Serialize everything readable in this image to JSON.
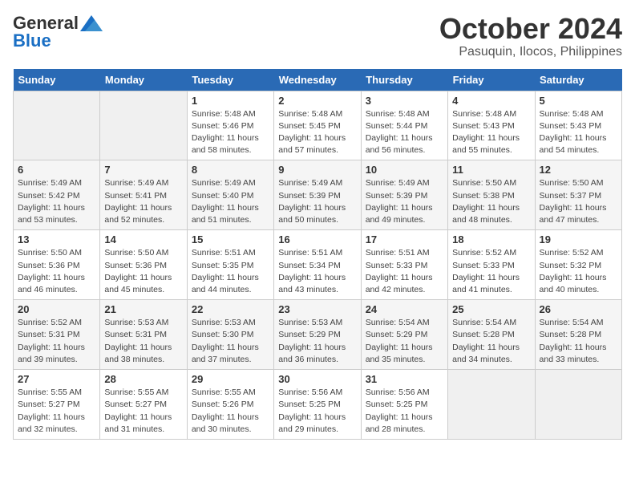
{
  "header": {
    "logo_general": "General",
    "logo_blue": "Blue",
    "month": "October 2024",
    "location": "Pasuquin, Ilocos, Philippines"
  },
  "weekdays": [
    "Sunday",
    "Monday",
    "Tuesday",
    "Wednesday",
    "Thursday",
    "Friday",
    "Saturday"
  ],
  "weeks": [
    [
      {
        "day": "",
        "info": ""
      },
      {
        "day": "",
        "info": ""
      },
      {
        "day": "1",
        "sunrise": "Sunrise: 5:48 AM",
        "sunset": "Sunset: 5:46 PM",
        "daylight": "Daylight: 11 hours and 58 minutes."
      },
      {
        "day": "2",
        "sunrise": "Sunrise: 5:48 AM",
        "sunset": "Sunset: 5:45 PM",
        "daylight": "Daylight: 11 hours and 57 minutes."
      },
      {
        "day": "3",
        "sunrise": "Sunrise: 5:48 AM",
        "sunset": "Sunset: 5:44 PM",
        "daylight": "Daylight: 11 hours and 56 minutes."
      },
      {
        "day": "4",
        "sunrise": "Sunrise: 5:48 AM",
        "sunset": "Sunset: 5:43 PM",
        "daylight": "Daylight: 11 hours and 55 minutes."
      },
      {
        "day": "5",
        "sunrise": "Sunrise: 5:48 AM",
        "sunset": "Sunset: 5:43 PM",
        "daylight": "Daylight: 11 hours and 54 minutes."
      }
    ],
    [
      {
        "day": "6",
        "sunrise": "Sunrise: 5:49 AM",
        "sunset": "Sunset: 5:42 PM",
        "daylight": "Daylight: 11 hours and 53 minutes."
      },
      {
        "day": "7",
        "sunrise": "Sunrise: 5:49 AM",
        "sunset": "Sunset: 5:41 PM",
        "daylight": "Daylight: 11 hours and 52 minutes."
      },
      {
        "day": "8",
        "sunrise": "Sunrise: 5:49 AM",
        "sunset": "Sunset: 5:40 PM",
        "daylight": "Daylight: 11 hours and 51 minutes."
      },
      {
        "day": "9",
        "sunrise": "Sunrise: 5:49 AM",
        "sunset": "Sunset: 5:39 PM",
        "daylight": "Daylight: 11 hours and 50 minutes."
      },
      {
        "day": "10",
        "sunrise": "Sunrise: 5:49 AM",
        "sunset": "Sunset: 5:39 PM",
        "daylight": "Daylight: 11 hours and 49 minutes."
      },
      {
        "day": "11",
        "sunrise": "Sunrise: 5:50 AM",
        "sunset": "Sunset: 5:38 PM",
        "daylight": "Daylight: 11 hours and 48 minutes."
      },
      {
        "day": "12",
        "sunrise": "Sunrise: 5:50 AM",
        "sunset": "Sunset: 5:37 PM",
        "daylight": "Daylight: 11 hours and 47 minutes."
      }
    ],
    [
      {
        "day": "13",
        "sunrise": "Sunrise: 5:50 AM",
        "sunset": "Sunset: 5:36 PM",
        "daylight": "Daylight: 11 hours and 46 minutes."
      },
      {
        "day": "14",
        "sunrise": "Sunrise: 5:50 AM",
        "sunset": "Sunset: 5:36 PM",
        "daylight": "Daylight: 11 hours and 45 minutes."
      },
      {
        "day": "15",
        "sunrise": "Sunrise: 5:51 AM",
        "sunset": "Sunset: 5:35 PM",
        "daylight": "Daylight: 11 hours and 44 minutes."
      },
      {
        "day": "16",
        "sunrise": "Sunrise: 5:51 AM",
        "sunset": "Sunset: 5:34 PM",
        "daylight": "Daylight: 11 hours and 43 minutes."
      },
      {
        "day": "17",
        "sunrise": "Sunrise: 5:51 AM",
        "sunset": "Sunset: 5:33 PM",
        "daylight": "Daylight: 11 hours and 42 minutes."
      },
      {
        "day": "18",
        "sunrise": "Sunrise: 5:52 AM",
        "sunset": "Sunset: 5:33 PM",
        "daylight": "Daylight: 11 hours and 41 minutes."
      },
      {
        "day": "19",
        "sunrise": "Sunrise: 5:52 AM",
        "sunset": "Sunset: 5:32 PM",
        "daylight": "Daylight: 11 hours and 40 minutes."
      }
    ],
    [
      {
        "day": "20",
        "sunrise": "Sunrise: 5:52 AM",
        "sunset": "Sunset: 5:31 PM",
        "daylight": "Daylight: 11 hours and 39 minutes."
      },
      {
        "day": "21",
        "sunrise": "Sunrise: 5:53 AM",
        "sunset": "Sunset: 5:31 PM",
        "daylight": "Daylight: 11 hours and 38 minutes."
      },
      {
        "day": "22",
        "sunrise": "Sunrise: 5:53 AM",
        "sunset": "Sunset: 5:30 PM",
        "daylight": "Daylight: 11 hours and 37 minutes."
      },
      {
        "day": "23",
        "sunrise": "Sunrise: 5:53 AM",
        "sunset": "Sunset: 5:29 PM",
        "daylight": "Daylight: 11 hours and 36 minutes."
      },
      {
        "day": "24",
        "sunrise": "Sunrise: 5:54 AM",
        "sunset": "Sunset: 5:29 PM",
        "daylight": "Daylight: 11 hours and 35 minutes."
      },
      {
        "day": "25",
        "sunrise": "Sunrise: 5:54 AM",
        "sunset": "Sunset: 5:28 PM",
        "daylight": "Daylight: 11 hours and 34 minutes."
      },
      {
        "day": "26",
        "sunrise": "Sunrise: 5:54 AM",
        "sunset": "Sunset: 5:28 PM",
        "daylight": "Daylight: 11 hours and 33 minutes."
      }
    ],
    [
      {
        "day": "27",
        "sunrise": "Sunrise: 5:55 AM",
        "sunset": "Sunset: 5:27 PM",
        "daylight": "Daylight: 11 hours and 32 minutes."
      },
      {
        "day": "28",
        "sunrise": "Sunrise: 5:55 AM",
        "sunset": "Sunset: 5:27 PM",
        "daylight": "Daylight: 11 hours and 31 minutes."
      },
      {
        "day": "29",
        "sunrise": "Sunrise: 5:55 AM",
        "sunset": "Sunset: 5:26 PM",
        "daylight": "Daylight: 11 hours and 30 minutes."
      },
      {
        "day": "30",
        "sunrise": "Sunrise: 5:56 AM",
        "sunset": "Sunset: 5:25 PM",
        "daylight": "Daylight: 11 hours and 29 minutes."
      },
      {
        "day": "31",
        "sunrise": "Sunrise: 5:56 AM",
        "sunset": "Sunset: 5:25 PM",
        "daylight": "Daylight: 11 hours and 28 minutes."
      },
      {
        "day": "",
        "info": ""
      },
      {
        "day": "",
        "info": ""
      }
    ]
  ]
}
